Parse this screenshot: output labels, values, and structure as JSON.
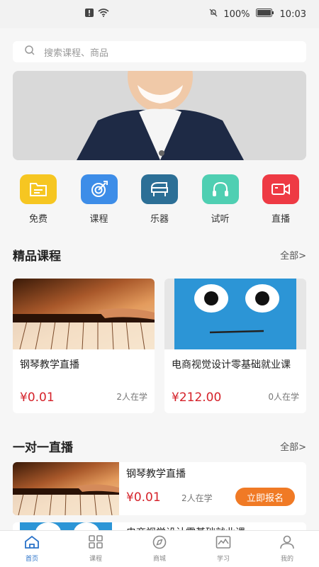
{
  "status": {
    "battery": "100%",
    "time": "10:03"
  },
  "search": {
    "placeholder": "搜索课程、商品"
  },
  "categories": [
    {
      "label": "免费",
      "color": "#f6c621",
      "icon": "folder-icon"
    },
    {
      "label": "课程",
      "color": "#3d8de8",
      "icon": "target-icon"
    },
    {
      "label": "乐器",
      "color": "#2c6f96",
      "icon": "piano-icon"
    },
    {
      "label": "试听",
      "color": "#4fcfb2",
      "icon": "headphones-icon"
    },
    {
      "label": "直播",
      "color": "#ee3a44",
      "icon": "video-camera-icon"
    }
  ],
  "featured": {
    "title": "精品课程",
    "more": "全部>",
    "courses": [
      {
        "title": "钢琴教学直播",
        "price": "¥0.01",
        "students": "2人在学"
      },
      {
        "title": "电商视觉设计零基础就业课",
        "price": "¥212.00",
        "students": "0人在学"
      }
    ]
  },
  "live": {
    "title": "一对一直播",
    "more": "全部>",
    "items": [
      {
        "title": "钢琴教学直播",
        "price": "¥0.01",
        "students": "2人在学",
        "button": "立即报名"
      },
      {
        "title": "电商视觉设计零基础就业课"
      }
    ]
  },
  "tabs": [
    {
      "label": "首页",
      "icon": "home-icon"
    },
    {
      "label": "课程",
      "icon": "grid-icon"
    },
    {
      "label": "商城",
      "icon": "compass-icon"
    },
    {
      "label": "学习",
      "icon": "chart-icon"
    },
    {
      "label": "我的",
      "icon": "user-icon"
    }
  ]
}
